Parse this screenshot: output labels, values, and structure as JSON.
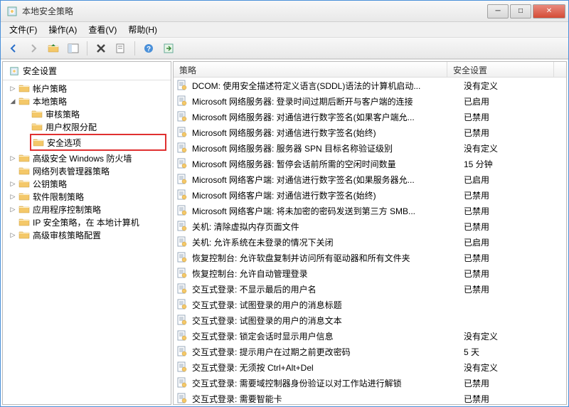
{
  "window": {
    "title": "本地安全策略"
  },
  "menu": {
    "file": "文件(F)",
    "action": "操作(A)",
    "view": "查看(V)",
    "help": "帮助(H)"
  },
  "tree": {
    "root": "安全设置",
    "nodes": {
      "account": "帐户策略",
      "local": "本地策略",
      "audit": "审核策略",
      "userrights": "用户权限分配",
      "secoptions": "安全选项",
      "firewall": "高级安全 Windows 防火墙",
      "netlist": "网络列表管理器策略",
      "pubkey": "公钥策略",
      "softrestrict": "软件限制策略",
      "appctrl": "应用程序控制策略",
      "ipsec": "IP 安全策略，在 本地计算机",
      "advaudit": "高级审核策略配置"
    }
  },
  "list": {
    "col_policy": "策略",
    "col_setting": "安全设置",
    "rows": [
      {
        "policy": "DCOM: 使用安全描述符定义语言(SDDL)语法的计算机启动...",
        "setting": "没有定义"
      },
      {
        "policy": "Microsoft 网络服务器: 登录时间过期后断开与客户端的连接",
        "setting": "已启用"
      },
      {
        "policy": "Microsoft 网络服务器: 对通信进行数字签名(如果客户端允...",
        "setting": "已禁用"
      },
      {
        "policy": "Microsoft 网络服务器: 对通信进行数字签名(始终)",
        "setting": "已禁用"
      },
      {
        "policy": "Microsoft 网络服务器: 服务器 SPN 目标名称验证级别",
        "setting": "没有定义"
      },
      {
        "policy": "Microsoft 网络服务器: 暂停会话前所需的空闲时间数量",
        "setting": "15 分钟"
      },
      {
        "policy": "Microsoft 网络客户端: 对通信进行数字签名(如果服务器允...",
        "setting": "已启用"
      },
      {
        "policy": "Microsoft 网络客户端: 对通信进行数字签名(始终)",
        "setting": "已禁用"
      },
      {
        "policy": "Microsoft 网络客户端: 将未加密的密码发送到第三方 SMB...",
        "setting": "已禁用"
      },
      {
        "policy": "关机: 清除虚拟内存页面文件",
        "setting": "已禁用"
      },
      {
        "policy": "关机: 允许系统在未登录的情况下关闭",
        "setting": "已启用"
      },
      {
        "policy": "恢复控制台: 允许软盘复制并访问所有驱动器和所有文件夹",
        "setting": "已禁用"
      },
      {
        "policy": "恢复控制台: 允许自动管理登录",
        "setting": "已禁用"
      },
      {
        "policy": "交互式登录: 不显示最后的用户名",
        "setting": "已禁用"
      },
      {
        "policy": "交互式登录: 试图登录的用户的消息标题",
        "setting": ""
      },
      {
        "policy": "交互式登录: 试图登录的用户的消息文本",
        "setting": ""
      },
      {
        "policy": "交互式登录: 锁定会话时显示用户信息",
        "setting": "没有定义"
      },
      {
        "policy": "交互式登录: 提示用户在过期之前更改密码",
        "setting": "5 天"
      },
      {
        "policy": "交互式登录: 无须按 Ctrl+Alt+Del",
        "setting": "没有定义"
      },
      {
        "policy": "交互式登录: 需要域控制器身份验证以对工作站进行解锁",
        "setting": "已禁用"
      },
      {
        "policy": "交互式登录: 需要智能卡",
        "setting": "已禁用"
      }
    ]
  }
}
